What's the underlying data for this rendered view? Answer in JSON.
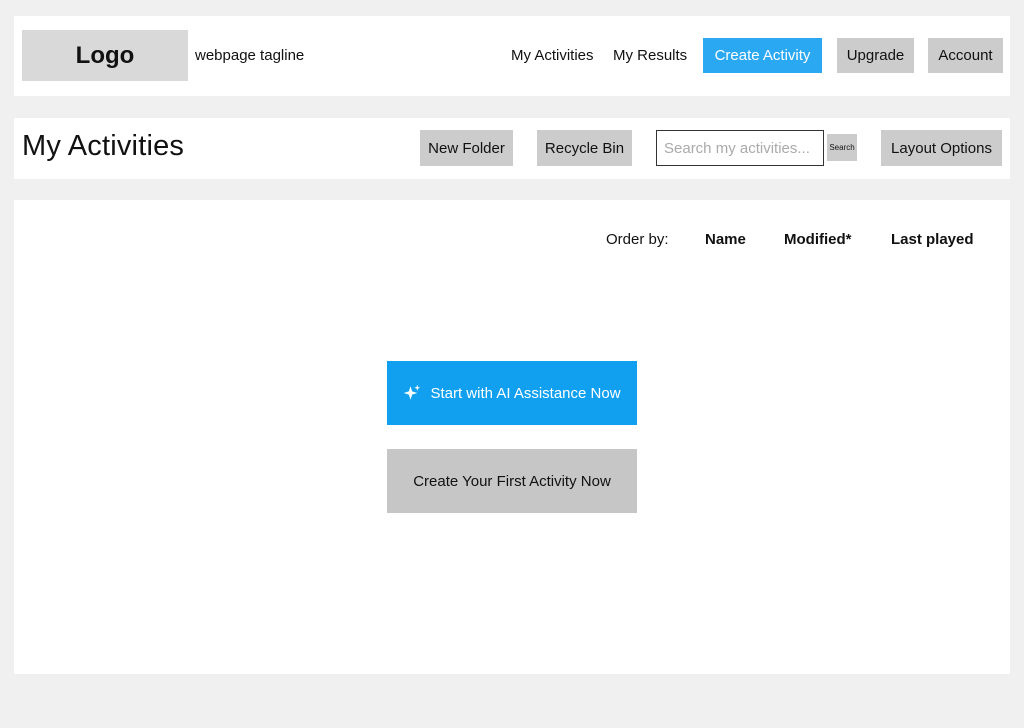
{
  "header": {
    "logo": "Logo",
    "tagline": "webpage tagline",
    "nav": {
      "my_activities": "My Activities",
      "my_results": "My Results",
      "create_activity": "Create Activity",
      "upgrade": "Upgrade",
      "account": "Account"
    }
  },
  "toolbar": {
    "title": "My Activities",
    "new_folder": "New Folder",
    "recycle_bin": "Recycle Bin",
    "search_placeholder": "Search my activities...",
    "search_button": "Search",
    "layout_options": "Layout Options"
  },
  "main": {
    "order_by_label": "Order by:",
    "order_options": {
      "name": "Name",
      "modified": "Modified*",
      "last_played": "Last played"
    },
    "ai_button": "Start with AI Assistance Now",
    "ai_icon": "sparkle-icon",
    "create_first_button": "Create Your First Activity Now"
  },
  "colors": {
    "background": "#f0f0f0",
    "panel": "#ffffff",
    "primary": "#10a0ef",
    "nav_primary": "#2ba8f2",
    "neutral_button": "#cccccc"
  }
}
